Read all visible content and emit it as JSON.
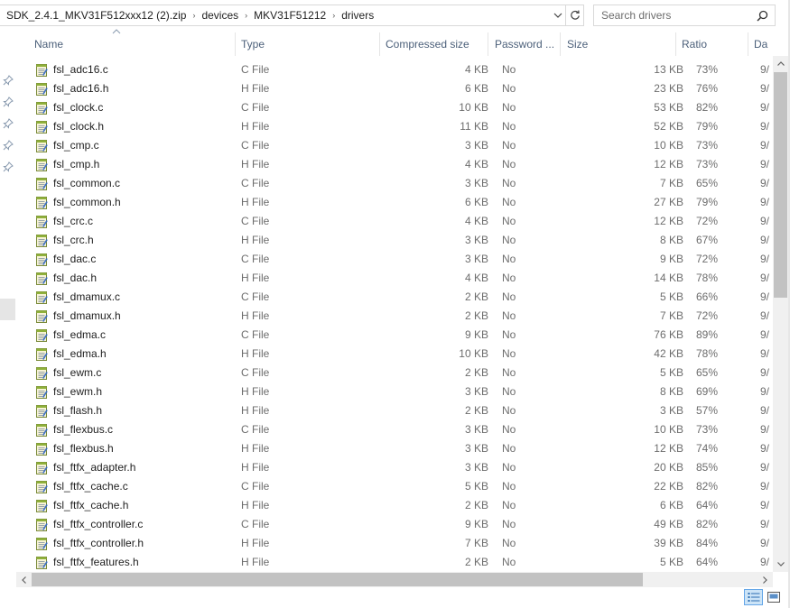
{
  "address": {
    "breadcrumbs": [
      "SDK_2.4.1_MKV31F512xxx12 (2).zip",
      "devices",
      "MKV31F51212",
      "drivers"
    ]
  },
  "search": {
    "placeholder": "Search drivers"
  },
  "columns": {
    "name": "Name",
    "type": "Type",
    "compressed_size": "Compressed size",
    "password": "Password ...",
    "size": "Size",
    "ratio": "Ratio",
    "date": "Da"
  },
  "files": [
    {
      "name": "fsl_adc16.c",
      "type": "C File",
      "compressed": "4 KB",
      "password": "No",
      "size": "13 KB",
      "ratio": "73%",
      "date": "9/"
    },
    {
      "name": "fsl_adc16.h",
      "type": "H File",
      "compressed": "6 KB",
      "password": "No",
      "size": "23 KB",
      "ratio": "76%",
      "date": "9/"
    },
    {
      "name": "fsl_clock.c",
      "type": "C File",
      "compressed": "10 KB",
      "password": "No",
      "size": "53 KB",
      "ratio": "82%",
      "date": "9/"
    },
    {
      "name": "fsl_clock.h",
      "type": "H File",
      "compressed": "11 KB",
      "password": "No",
      "size": "52 KB",
      "ratio": "79%",
      "date": "9/"
    },
    {
      "name": "fsl_cmp.c",
      "type": "C File",
      "compressed": "3 KB",
      "password": "No",
      "size": "10 KB",
      "ratio": "73%",
      "date": "9/"
    },
    {
      "name": "fsl_cmp.h",
      "type": "H File",
      "compressed": "4 KB",
      "password": "No",
      "size": "12 KB",
      "ratio": "73%",
      "date": "9/"
    },
    {
      "name": "fsl_common.c",
      "type": "C File",
      "compressed": "3 KB",
      "password": "No",
      "size": "7 KB",
      "ratio": "65%",
      "date": "9/"
    },
    {
      "name": "fsl_common.h",
      "type": "H File",
      "compressed": "6 KB",
      "password": "No",
      "size": "27 KB",
      "ratio": "79%",
      "date": "9/"
    },
    {
      "name": "fsl_crc.c",
      "type": "C File",
      "compressed": "4 KB",
      "password": "No",
      "size": "12 KB",
      "ratio": "72%",
      "date": "9/"
    },
    {
      "name": "fsl_crc.h",
      "type": "H File",
      "compressed": "3 KB",
      "password": "No",
      "size": "8 KB",
      "ratio": "67%",
      "date": "9/"
    },
    {
      "name": "fsl_dac.c",
      "type": "C File",
      "compressed": "3 KB",
      "password": "No",
      "size": "9 KB",
      "ratio": "72%",
      "date": "9/"
    },
    {
      "name": "fsl_dac.h",
      "type": "H File",
      "compressed": "4 KB",
      "password": "No",
      "size": "14 KB",
      "ratio": "78%",
      "date": "9/"
    },
    {
      "name": "fsl_dmamux.c",
      "type": "C File",
      "compressed": "2 KB",
      "password": "No",
      "size": "5 KB",
      "ratio": "66%",
      "date": "9/"
    },
    {
      "name": "fsl_dmamux.h",
      "type": "H File",
      "compressed": "2 KB",
      "password": "No",
      "size": "7 KB",
      "ratio": "72%",
      "date": "9/"
    },
    {
      "name": "fsl_edma.c",
      "type": "C File",
      "compressed": "9 KB",
      "password": "No",
      "size": "76 KB",
      "ratio": "89%",
      "date": "9/"
    },
    {
      "name": "fsl_edma.h",
      "type": "H File",
      "compressed": "10 KB",
      "password": "No",
      "size": "42 KB",
      "ratio": "78%",
      "date": "9/"
    },
    {
      "name": "fsl_ewm.c",
      "type": "C File",
      "compressed": "2 KB",
      "password": "No",
      "size": "5 KB",
      "ratio": "65%",
      "date": "9/"
    },
    {
      "name": "fsl_ewm.h",
      "type": "H File",
      "compressed": "3 KB",
      "password": "No",
      "size": "8 KB",
      "ratio": "69%",
      "date": "9/"
    },
    {
      "name": "fsl_flash.h",
      "type": "H File",
      "compressed": "2 KB",
      "password": "No",
      "size": "3 KB",
      "ratio": "57%",
      "date": "9/"
    },
    {
      "name": "fsl_flexbus.c",
      "type": "C File",
      "compressed": "3 KB",
      "password": "No",
      "size": "10 KB",
      "ratio": "73%",
      "date": "9/"
    },
    {
      "name": "fsl_flexbus.h",
      "type": "H File",
      "compressed": "3 KB",
      "password": "No",
      "size": "12 KB",
      "ratio": "74%",
      "date": "9/"
    },
    {
      "name": "fsl_ftfx_adapter.h",
      "type": "H File",
      "compressed": "3 KB",
      "password": "No",
      "size": "20 KB",
      "ratio": "85%",
      "date": "9/"
    },
    {
      "name": "fsl_ftfx_cache.c",
      "type": "C File",
      "compressed": "5 KB",
      "password": "No",
      "size": "22 KB",
      "ratio": "82%",
      "date": "9/"
    },
    {
      "name": "fsl_ftfx_cache.h",
      "type": "H File",
      "compressed": "2 KB",
      "password": "No",
      "size": "6 KB",
      "ratio": "64%",
      "date": "9/"
    },
    {
      "name": "fsl_ftfx_controller.c",
      "type": "C File",
      "compressed": "9 KB",
      "password": "No",
      "size": "49 KB",
      "ratio": "82%",
      "date": "9/"
    },
    {
      "name": "fsl_ftfx_controller.h",
      "type": "H File",
      "compressed": "7 KB",
      "password": "No",
      "size": "39 KB",
      "ratio": "84%",
      "date": "9/"
    },
    {
      "name": "fsl_ftfx_features.h",
      "type": "H File",
      "compressed": "2 KB",
      "password": "No",
      "size": "5 KB",
      "ratio": "64%",
      "date": "9/"
    }
  ],
  "icons": {
    "file": "notepad-file-icon",
    "pin": "pin-icon",
    "search": "search-icon",
    "refresh": "refresh-icon",
    "details_view": "details-view-icon",
    "tiles_view": "large-icons-view-icon"
  },
  "colors": {
    "header_text": "#4c607a",
    "secondary_text": "#6d6d6d",
    "selection_border": "#66a7e8",
    "selection_fill": "#cce4f7"
  }
}
